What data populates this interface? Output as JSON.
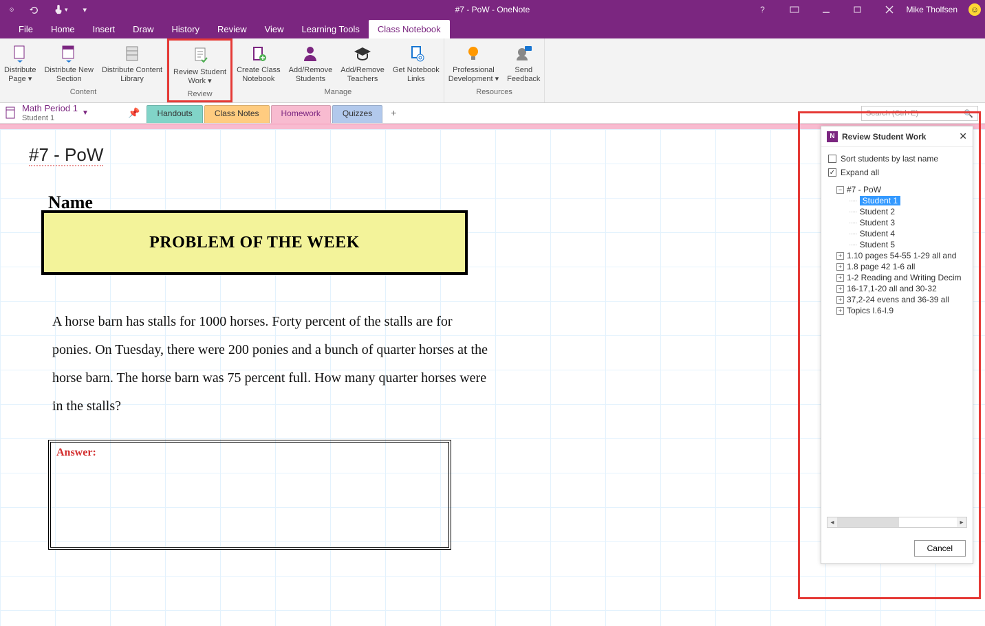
{
  "titlebar": {
    "app_title": "#7 - PoW - OneNote",
    "user": "Mike Tholfsen"
  },
  "menu": {
    "items": [
      "File",
      "Home",
      "Insert",
      "Draw",
      "History",
      "Review",
      "View",
      "Learning Tools",
      "Class Notebook"
    ],
    "active_index": 8
  },
  "ribbon": {
    "groups": [
      {
        "label": "Content",
        "buttons": [
          {
            "label": "Distribute Page",
            "dropdown": true,
            "icon": "page-arrow"
          },
          {
            "label": "Distribute New Section",
            "icon": "section-arrow"
          },
          {
            "label": "Distribute Content Library",
            "icon": "library"
          }
        ]
      },
      {
        "label": "Review",
        "highlight": true,
        "buttons": [
          {
            "label": "Review Student Work",
            "dropdown": true,
            "icon": "doc-check"
          }
        ]
      },
      {
        "label": "Manage",
        "buttons": [
          {
            "label": "Create Class Notebook",
            "icon": "notebook-plus"
          },
          {
            "label": "Add/Remove Students",
            "icon": "person"
          },
          {
            "label": "Add/Remove Teachers",
            "icon": "grad-cap"
          },
          {
            "label": "Get Notebook Links",
            "icon": "links"
          }
        ]
      },
      {
        "label": "Resources",
        "buttons": [
          {
            "label": "Professional Development",
            "dropdown": true,
            "icon": "bulb"
          },
          {
            "label": "Send Feedback",
            "icon": "feedback"
          }
        ]
      }
    ]
  },
  "notebook_select": {
    "title": "Math Period 1",
    "sub": "Student 1"
  },
  "section_tabs": [
    {
      "label": "Handouts",
      "cls": "tab-handouts"
    },
    {
      "label": "Class Notes",
      "cls": "tab-classnotes"
    },
    {
      "label": "Homework",
      "cls": "tab-homework"
    },
    {
      "label": "Quizzes",
      "cls": "tab-quizzes"
    }
  ],
  "search_placeholder": "Search (Ctrl+E)",
  "page": {
    "title": "#7 - PoW",
    "name_label": "Name",
    "pow_heading": "PROBLEM OF THE WEEK",
    "problem_text": "A horse barn has stalls for 1000 horses. Forty percent of the stalls are for ponies. On Tuesday, there were 200 ponies and a bunch of quarter horses at the horse barn. The horse barn was 75 percent full. How many quarter horses were in the stalls?",
    "answer_label": "Answer:"
  },
  "side_panel": {
    "title": "Review Student Work",
    "sort_label": "Sort students by last name",
    "expand_label": "Expand all",
    "expand_checked": true,
    "tree_root": "#7 - PoW",
    "students": [
      "Student 1",
      "Student 2",
      "Student 3",
      "Student 4",
      "Student 5"
    ],
    "selected_student": 0,
    "other_pages": [
      "1.10 pages 54-55 1-29 all and",
      "1.8 page 42 1-6 all",
      "1-2 Reading and Writing Decim",
      "16-17,1-20 all and 30-32",
      "37,2-24 evens and 36-39 all",
      "Topics I.6-I.9"
    ],
    "cancel_label": "Cancel"
  }
}
